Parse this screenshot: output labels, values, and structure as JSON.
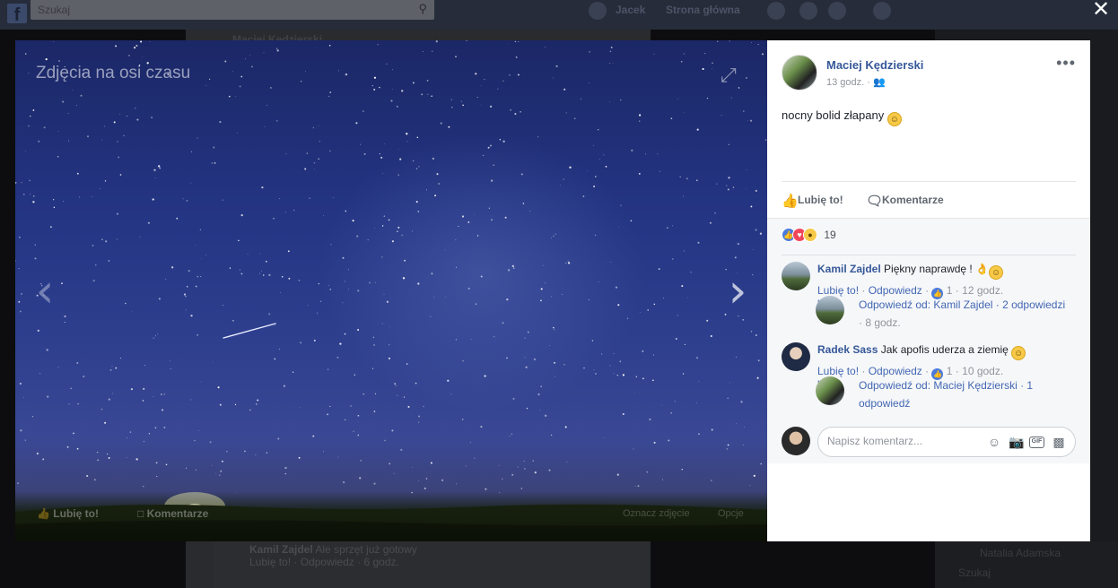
{
  "background_page": {
    "search_placeholder": "Szukaj",
    "nav_user": "Jacek",
    "nav_home": "Strona główna",
    "feed_header_author": "Maciej Kędzierski",
    "feed_comment_author": "Kamil Zajdel",
    "feed_comment_text": "Ale sprzęt już gotowy",
    "feed_comment_like": "Lubię to!",
    "feed_comment_reply": "Odpowiedz",
    "feed_comment_time": "6 godz.",
    "chat_contact": "Natalia Adamska",
    "chat_search": "Szukaj"
  },
  "viewer": {
    "title": "Zdjęcia na osi czasu",
    "like_label": "Lubię to!",
    "comment_label": "Komentarze",
    "tag_label": "Oznacz zdjęcie",
    "options_label": "Opcje"
  },
  "post": {
    "author": "Maciej Kędzierski",
    "time": "13 godz.",
    "text": "nocny bolid złapany",
    "like_label": "Lubię to!",
    "comment_label": "Komentarze",
    "reaction_count": "19"
  },
  "comments": [
    {
      "author": "Kamil Zajdel",
      "text": "Piękny naprawdę !",
      "like_link": "Lubię to!",
      "reply_link": "Odpowiedz",
      "likes": "1",
      "time": "12 godz.",
      "reply_summary": "Odpowiedź od: Kamil Zajdel · 2 odpowiedzi",
      "reply_time": "· 8 godz."
    },
    {
      "author": "Radek Sass",
      "text": "Jak apofis uderza a ziemię",
      "like_link": "Lubię to!",
      "reply_link": "Odpowiedz",
      "likes": "1",
      "time": "10 godz.",
      "reply_summary": "Odpowiedź od: Maciej Kędzierski · 1 odpowiedź"
    }
  ],
  "composer": {
    "placeholder": "Napisz komentarz..."
  },
  "colors": {
    "link": "#365899",
    "accent": "#4267b2",
    "panel_bg": "#ffffff",
    "comments_bg": "#f6f7f9"
  }
}
